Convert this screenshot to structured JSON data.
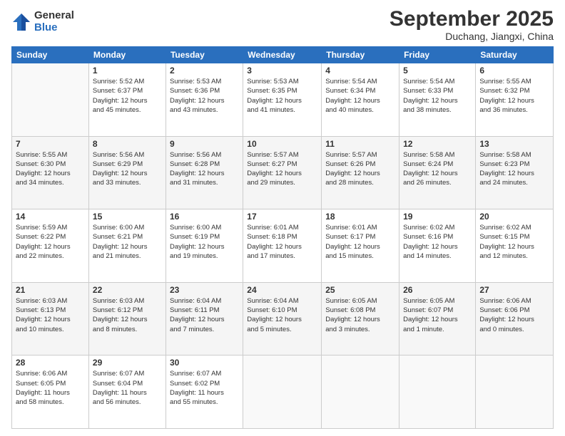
{
  "logo": {
    "general": "General",
    "blue": "Blue"
  },
  "title": "September 2025",
  "subtitle": "Duchang, Jiangxi, China",
  "weekdays": [
    "Sunday",
    "Monday",
    "Tuesday",
    "Wednesday",
    "Thursday",
    "Friday",
    "Saturday"
  ],
  "weeks": [
    [
      {
        "day": "",
        "info": ""
      },
      {
        "day": "1",
        "info": "Sunrise: 5:52 AM\nSunset: 6:37 PM\nDaylight: 12 hours\nand 45 minutes."
      },
      {
        "day": "2",
        "info": "Sunrise: 5:53 AM\nSunset: 6:36 PM\nDaylight: 12 hours\nand 43 minutes."
      },
      {
        "day": "3",
        "info": "Sunrise: 5:53 AM\nSunset: 6:35 PM\nDaylight: 12 hours\nand 41 minutes."
      },
      {
        "day": "4",
        "info": "Sunrise: 5:54 AM\nSunset: 6:34 PM\nDaylight: 12 hours\nand 40 minutes."
      },
      {
        "day": "5",
        "info": "Sunrise: 5:54 AM\nSunset: 6:33 PM\nDaylight: 12 hours\nand 38 minutes."
      },
      {
        "day": "6",
        "info": "Sunrise: 5:55 AM\nSunset: 6:32 PM\nDaylight: 12 hours\nand 36 minutes."
      }
    ],
    [
      {
        "day": "7",
        "info": "Sunrise: 5:55 AM\nSunset: 6:30 PM\nDaylight: 12 hours\nand 34 minutes."
      },
      {
        "day": "8",
        "info": "Sunrise: 5:56 AM\nSunset: 6:29 PM\nDaylight: 12 hours\nand 33 minutes."
      },
      {
        "day": "9",
        "info": "Sunrise: 5:56 AM\nSunset: 6:28 PM\nDaylight: 12 hours\nand 31 minutes."
      },
      {
        "day": "10",
        "info": "Sunrise: 5:57 AM\nSunset: 6:27 PM\nDaylight: 12 hours\nand 29 minutes."
      },
      {
        "day": "11",
        "info": "Sunrise: 5:57 AM\nSunset: 6:26 PM\nDaylight: 12 hours\nand 28 minutes."
      },
      {
        "day": "12",
        "info": "Sunrise: 5:58 AM\nSunset: 6:24 PM\nDaylight: 12 hours\nand 26 minutes."
      },
      {
        "day": "13",
        "info": "Sunrise: 5:58 AM\nSunset: 6:23 PM\nDaylight: 12 hours\nand 24 minutes."
      }
    ],
    [
      {
        "day": "14",
        "info": "Sunrise: 5:59 AM\nSunset: 6:22 PM\nDaylight: 12 hours\nand 22 minutes."
      },
      {
        "day": "15",
        "info": "Sunrise: 6:00 AM\nSunset: 6:21 PM\nDaylight: 12 hours\nand 21 minutes."
      },
      {
        "day": "16",
        "info": "Sunrise: 6:00 AM\nSunset: 6:19 PM\nDaylight: 12 hours\nand 19 minutes."
      },
      {
        "day": "17",
        "info": "Sunrise: 6:01 AM\nSunset: 6:18 PM\nDaylight: 12 hours\nand 17 minutes."
      },
      {
        "day": "18",
        "info": "Sunrise: 6:01 AM\nSunset: 6:17 PM\nDaylight: 12 hours\nand 15 minutes."
      },
      {
        "day": "19",
        "info": "Sunrise: 6:02 AM\nSunset: 6:16 PM\nDaylight: 12 hours\nand 14 minutes."
      },
      {
        "day": "20",
        "info": "Sunrise: 6:02 AM\nSunset: 6:15 PM\nDaylight: 12 hours\nand 12 minutes."
      }
    ],
    [
      {
        "day": "21",
        "info": "Sunrise: 6:03 AM\nSunset: 6:13 PM\nDaylight: 12 hours\nand 10 minutes."
      },
      {
        "day": "22",
        "info": "Sunrise: 6:03 AM\nSunset: 6:12 PM\nDaylight: 12 hours\nand 8 minutes."
      },
      {
        "day": "23",
        "info": "Sunrise: 6:04 AM\nSunset: 6:11 PM\nDaylight: 12 hours\nand 7 minutes."
      },
      {
        "day": "24",
        "info": "Sunrise: 6:04 AM\nSunset: 6:10 PM\nDaylight: 12 hours\nand 5 minutes."
      },
      {
        "day": "25",
        "info": "Sunrise: 6:05 AM\nSunset: 6:08 PM\nDaylight: 12 hours\nand 3 minutes."
      },
      {
        "day": "26",
        "info": "Sunrise: 6:05 AM\nSunset: 6:07 PM\nDaylight: 12 hours\nand 1 minute."
      },
      {
        "day": "27",
        "info": "Sunrise: 6:06 AM\nSunset: 6:06 PM\nDaylight: 12 hours\nand 0 minutes."
      }
    ],
    [
      {
        "day": "28",
        "info": "Sunrise: 6:06 AM\nSunset: 6:05 PM\nDaylight: 11 hours\nand 58 minutes."
      },
      {
        "day": "29",
        "info": "Sunrise: 6:07 AM\nSunset: 6:04 PM\nDaylight: 11 hours\nand 56 minutes."
      },
      {
        "day": "30",
        "info": "Sunrise: 6:07 AM\nSunset: 6:02 PM\nDaylight: 11 hours\nand 55 minutes."
      },
      {
        "day": "",
        "info": ""
      },
      {
        "day": "",
        "info": ""
      },
      {
        "day": "",
        "info": ""
      },
      {
        "day": "",
        "info": ""
      }
    ]
  ]
}
